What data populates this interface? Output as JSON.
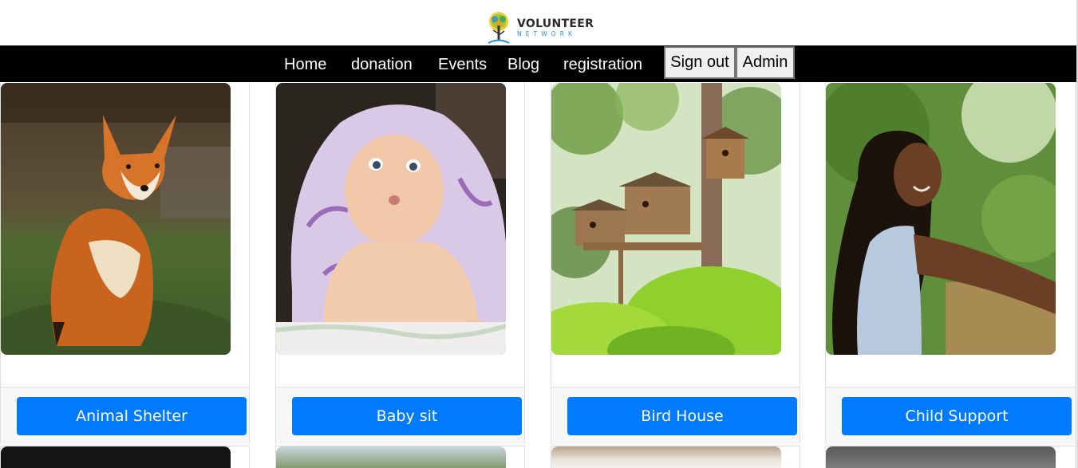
{
  "brand": {
    "title": "VOLUNTEER",
    "subtitle": "NETWORK",
    "logo_icon": "tree-icon",
    "colors": {
      "title": "#2a2a2a",
      "subtitle": "#2f8bd6"
    }
  },
  "nav": {
    "links": [
      "Home",
      "donation",
      "Events",
      "Blog",
      "registration"
    ],
    "sign_out_label": "Sign out",
    "admin_label": "Admin",
    "background": "#000000"
  },
  "events": [
    {
      "title": "Animal Shelter",
      "image": "fox-photo"
    },
    {
      "title": "Baby sit",
      "image": "baby-photo"
    },
    {
      "title": "Bird House",
      "image": "birdhouse-photo"
    },
    {
      "title": "Child Support",
      "image": "girl-photo"
    }
  ],
  "accent_color": "#007bff"
}
